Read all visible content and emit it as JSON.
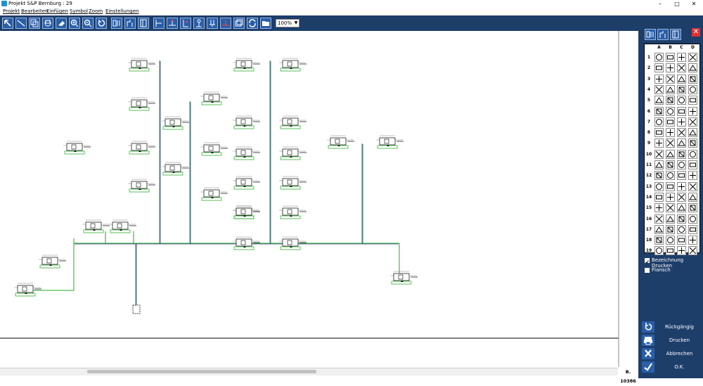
{
  "window": {
    "title": "Projekt S&P Bernburg :  29",
    "controls": [
      "minimize",
      "maximize",
      "close"
    ]
  },
  "menu": [
    "Projekt",
    "Bearbeiten",
    "Einfügen",
    "Symbol",
    "Zoom",
    "Einstellungen"
  ],
  "toolbar": {
    "buttons": [
      "pointer-icon",
      "line-icon",
      "copy-icon",
      "move-icon",
      "erase-icon",
      "zoom-in-icon",
      "zoom-out-icon",
      "undo-icon",
      "tool-a-icon",
      "tool-b-icon",
      "tool-c-icon",
      "symbol-a-icon",
      "symbol-b-icon",
      "symbol-c-icon",
      "symbol-d-icon",
      "symbol-e-icon",
      "symbol-f-icon",
      "windows-icon",
      "refresh-icon",
      "folder-icon"
    ],
    "zoom": "100%"
  },
  "status": {
    "counter": "B. 10386"
  },
  "panel": {
    "columns": [
      "A",
      "B",
      "C",
      "D"
    ],
    "rows": [
      "1",
      "2",
      "3",
      "4",
      "5",
      "6",
      "7",
      "8",
      "9",
      "10",
      "11",
      "12",
      "13",
      "14",
      "15",
      "16",
      "17",
      "18",
      "19"
    ],
    "checkboxes": [
      {
        "label": "Bezeichnung Drucken",
        "checked": true
      },
      {
        "label": "Flansch",
        "checked": false
      }
    ],
    "buttons": [
      {
        "label": "Rückgängig",
        "icon": "undo-icon"
      },
      {
        "label": "Drucken",
        "icon": "printer-icon"
      },
      {
        "label": "Abbrechen",
        "icon": "cancel-icon"
      },
      {
        "label": "O.K.",
        "icon": "ok-icon"
      }
    ]
  },
  "colors": {
    "toolbar": "#1e3e6a",
    "button": "#2a5ea8",
    "pipe_green": "#22aa22",
    "close_red": "#dd3333"
  }
}
